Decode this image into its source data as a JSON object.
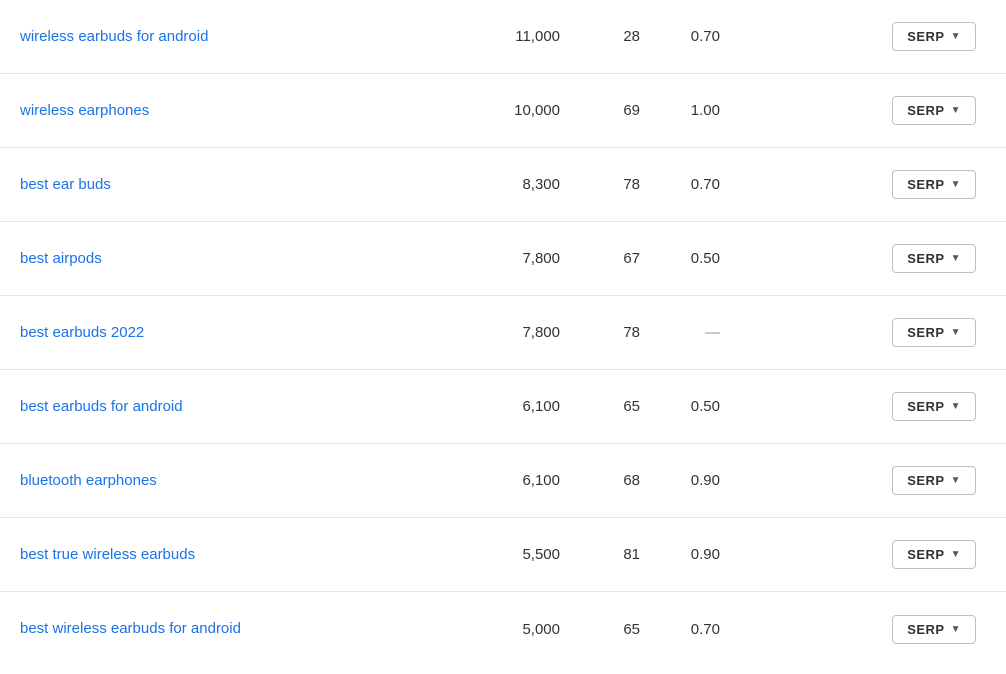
{
  "colors": {
    "link": "#1a73e8",
    "text": "#333333",
    "border": "#e8e8e8",
    "button_border": "#c0c0c0",
    "dash": "#999999"
  },
  "table": {
    "serp_button_label": "SERP",
    "rows": [
      {
        "keyword": "wireless earbuds for android",
        "volume": "11,000",
        "difficulty": "28",
        "cpc": "0.70"
      },
      {
        "keyword": "wireless earphones",
        "volume": "10,000",
        "difficulty": "69",
        "cpc": "1.00"
      },
      {
        "keyword": "best ear buds",
        "volume": "8,300",
        "difficulty": "78",
        "cpc": "0.70"
      },
      {
        "keyword": "best airpods",
        "volume": "7,800",
        "difficulty": "67",
        "cpc": "0.50"
      },
      {
        "keyword": "best earbuds 2022",
        "volume": "7,800",
        "difficulty": "78",
        "cpc": "—"
      },
      {
        "keyword": "best earbuds for android",
        "volume": "6,100",
        "difficulty": "65",
        "cpc": "0.50"
      },
      {
        "keyword": "bluetooth earphones",
        "volume": "6,100",
        "difficulty": "68",
        "cpc": "0.90"
      },
      {
        "keyword": "best true wireless earbuds",
        "volume": "5,500",
        "difficulty": "81",
        "cpc": "0.90"
      },
      {
        "keyword": "best wireless earbuds for android",
        "volume": "5,000",
        "difficulty": "65",
        "cpc": "0.70"
      }
    ]
  }
}
